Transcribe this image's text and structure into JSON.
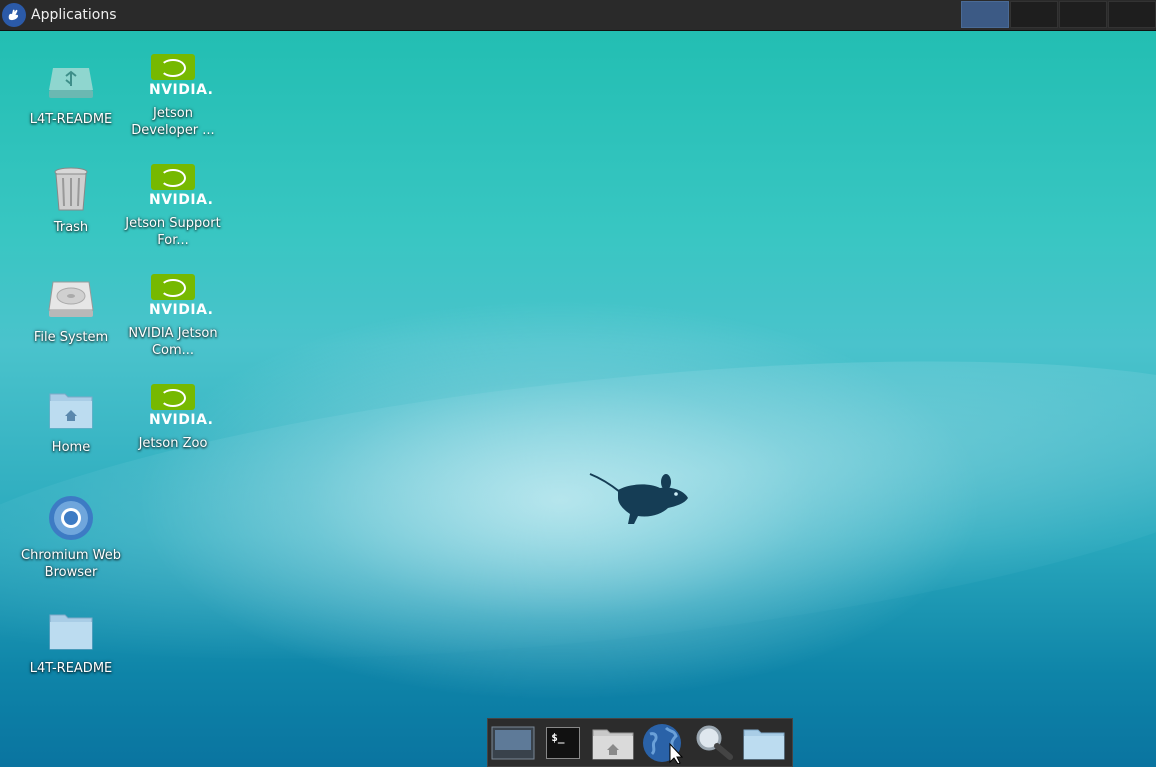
{
  "panel": {
    "menu_label": "Applications",
    "workspaces": [
      "ws1",
      "ws2",
      "ws3",
      "ws4"
    ],
    "active_workspace": 0
  },
  "desktop": {
    "icons": [
      {
        "label": "L4T-README",
        "icon": "usb-drive-icon"
      },
      {
        "label": "Jetson Developer ...",
        "icon": "nvidia-logo-icon"
      },
      {
        "label": "Trash",
        "icon": "trash-icon"
      },
      {
        "label": "Jetson Support For...",
        "icon": "nvidia-logo-icon"
      },
      {
        "label": "File System",
        "icon": "hard-drive-icon"
      },
      {
        "label": "NVIDIA Jetson Com...",
        "icon": "nvidia-logo-icon"
      },
      {
        "label": "Home",
        "icon": "home-folder-icon"
      },
      {
        "label": "Jetson Zoo",
        "icon": "nvidia-logo-icon"
      },
      {
        "label": "Chromium Web Browser",
        "icon": "chromium-icon"
      },
      {
        "label": "L4T-README",
        "icon": "folder-icon"
      }
    ],
    "nvidia_wordmark": "NVIDIA."
  },
  "dock": {
    "items": [
      {
        "name": "show-desktop",
        "icon": "desktop-icon"
      },
      {
        "name": "terminal",
        "icon": "terminal-icon",
        "glyph": "$_"
      },
      {
        "name": "file-manager",
        "icon": "home-folder-icon"
      },
      {
        "name": "web-browser",
        "icon": "globe-icon"
      },
      {
        "name": "app-finder",
        "icon": "magnifier-icon"
      },
      {
        "name": "folder",
        "icon": "folder-icon"
      }
    ]
  },
  "colors": {
    "panel_bg": "#2a2a2a",
    "active_workspace": "#3c5a85",
    "nvidia_green": "#76b900",
    "desktop_teal": "#2aa9bd"
  }
}
